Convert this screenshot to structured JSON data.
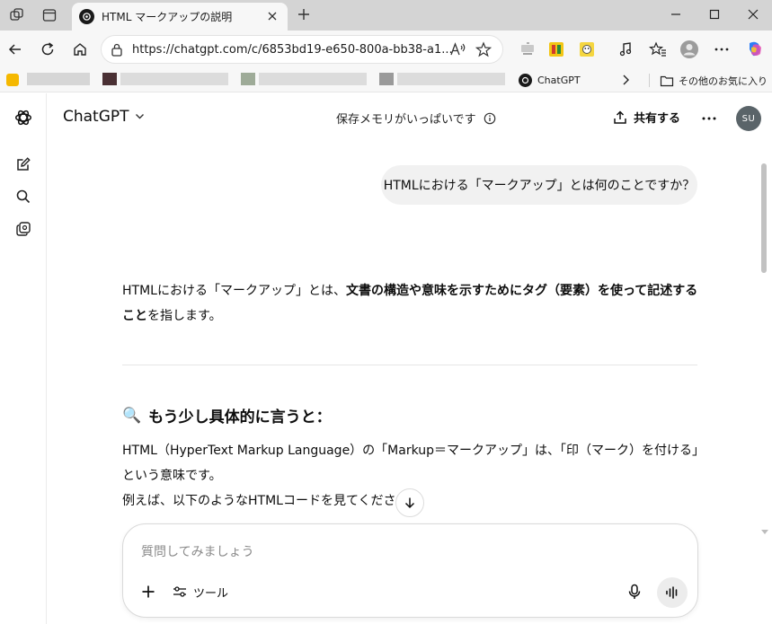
{
  "browser": {
    "tab": {
      "title": "HTML マークアップの説明"
    },
    "address_bar": {
      "url": "https://chatgpt.com/c/6853bd19-e650-800a-bb38-a1..."
    },
    "bookmarks": {
      "chatgpt_label": "ChatGPT",
      "other_label": "その他のお気に入り"
    }
  },
  "app": {
    "header": {
      "model_label": "ChatGPT",
      "memory_status": "保存メモリがいっぱいです",
      "share_label": "共有する",
      "avatar_initials": "SU"
    },
    "conversation": {
      "user_message": "HTMLにおける「マークアップ」とは何のことですか？",
      "answer_intro_plain": "HTMLにおける「マークアップ」とは、",
      "answer_intro_bold": "文書の構造や意味を示すためにタグ（要素）を使って記述すること",
      "answer_intro_end": "を指します。",
      "section_emoji": "🔍",
      "section_heading": "もう少し具体的に言うと：",
      "paragraph_1": "HTML（HyperText Markup Language）の「Markup＝マークアップ」は、「印（マーク）を付ける」という意味です。",
      "paragraph_2": "例えば、以下のようなHTMLコードを見てください："
    },
    "composer": {
      "placeholder": "質問してみましょう",
      "tools_label": "ツール"
    }
  },
  "colors": {
    "tab_strip": "#d4d4d4",
    "toolbar": "#f7f7f7",
    "user_bubble": "#f1f1f1",
    "avatar": "#5a6469"
  }
}
